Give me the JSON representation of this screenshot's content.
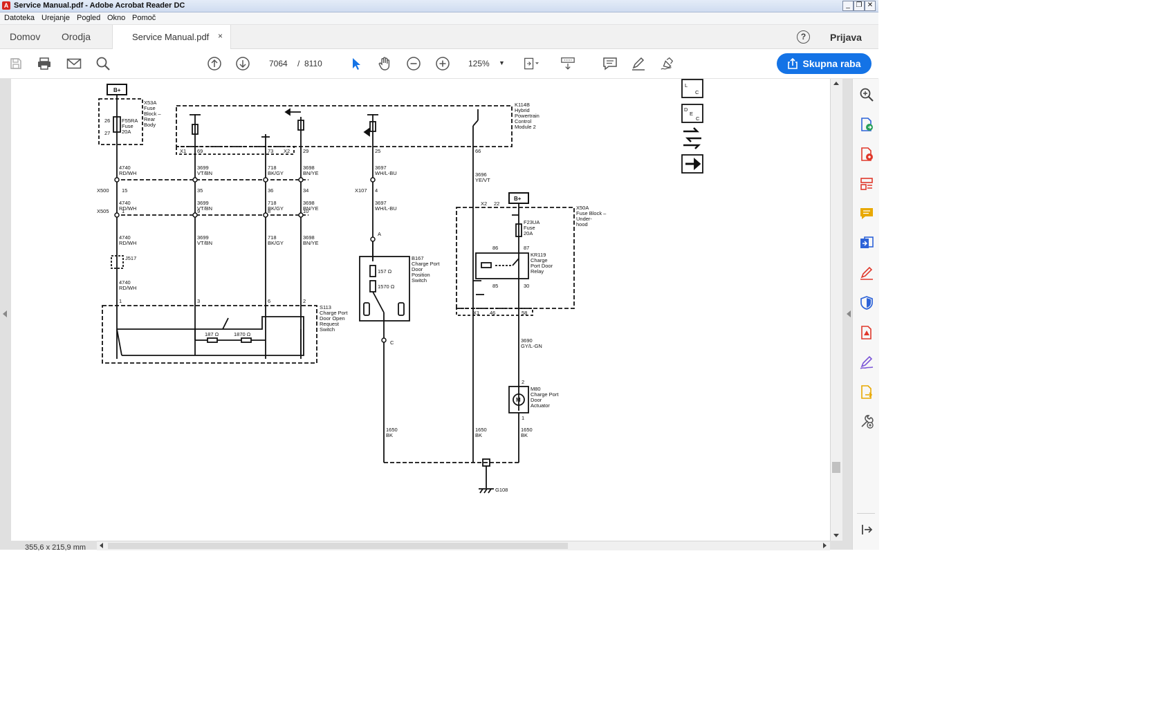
{
  "window": {
    "title": "Service  Manual.pdf - Adobe Acrobat Reader DC",
    "controls": [
      "_",
      "❐",
      "✕"
    ]
  },
  "menu": [
    "Datoteka",
    "Urejanje",
    "Pogled",
    "Okno",
    "Pomoč"
  ],
  "tabs": {
    "home": "Domov",
    "tools": "Orodja",
    "document": "Service  Manual.pdf",
    "close": "×"
  },
  "header": {
    "help": "?",
    "signin": "Prijava"
  },
  "toolbar": {
    "current_page": "7064",
    "page_separator": "/",
    "total_pages": "8110",
    "zoom": "125%",
    "share_label": "Skupna raba",
    "icons": [
      "save-icon",
      "print-icon",
      "email-icon",
      "search-icon",
      "page-up-icon",
      "page-down-icon",
      "select-cursor-icon",
      "hand-icon",
      "zoom-out-icon",
      "zoom-in-icon",
      "fit-page-icon",
      "scroll-mode-icon",
      "comment-icon",
      "highlight-pen-icon",
      "sign-icon",
      "share-icon"
    ]
  },
  "status": {
    "page_size": "355,6 x 215,9 mm"
  },
  "right_panel": {
    "icons": [
      "zoom-tool-icon",
      "export-pdf-icon",
      "create-pdf-icon",
      "organize-pages-icon",
      "comment-tool-icon",
      "send-for-review-icon",
      "fill-sign-icon",
      "protect-icon",
      "optimize-pdf-icon",
      "request-signature-icon",
      "send-file-icon",
      "more-tools-icon",
      "collapse-panel-icon"
    ],
    "colors": {
      "red": "#e0382b",
      "blue": "#2d63d8",
      "yellow": "#e8a800",
      "purple": "#7b55d8"
    }
  },
  "schematic": {
    "b_plus_left": "B+",
    "b_plus_right": "B+",
    "x53a": [
      "X53A",
      "Fuse",
      "Block –",
      "Rear",
      "Body"
    ],
    "f55ra": [
      "F55RA",
      "Fuse",
      "20A"
    ],
    "x53a_pins": [
      "26",
      "27"
    ],
    "k114b": [
      "K114B",
      "Hybrid",
      "Powertrain",
      "Control",
      "Module 2"
    ],
    "k114b_conn": [
      "X1",
      "69",
      "73",
      "X2",
      "29",
      "25",
      "66"
    ],
    "wire_4740_rdwh": [
      "4740",
      "RD/WH"
    ],
    "wire_3699_vtbn": [
      "3699",
      "VT/BN"
    ],
    "wire_718_bkgy": [
      "718",
      "BK/GY"
    ],
    "wire_3698_bnye": [
      "3698",
      "BN/YE"
    ],
    "wire_3697_whlbu": [
      "3697",
      "WH/L-BU"
    ],
    "wire_3696_yevt": [
      "3696",
      "YE/VT"
    ],
    "x500": [
      "X500",
      "15",
      "35",
      "36",
      "34"
    ],
    "x107": [
      "X107",
      "4"
    ],
    "x505": [
      "X505",
      "1",
      "9",
      "8",
      "10"
    ],
    "j517": "J517",
    "s113": [
      "S113",
      "Charge Port",
      "Door Open",
      "Request",
      "Switch"
    ],
    "s113_pins": [
      "1",
      "3",
      "6",
      "2"
    ],
    "s113_res": [
      "187 Ω",
      "1870 Ω"
    ],
    "b167": [
      "B167",
      "Charge Port",
      "Door",
      "Position",
      "Switch"
    ],
    "b167_res": [
      "157 Ω",
      "1570 Ω"
    ],
    "b167_pins": [
      "A",
      "C"
    ],
    "x50a": [
      "X50A",
      "Fuse Block –",
      "Under-",
      "hood"
    ],
    "x50a_conn": [
      "X2",
      "22"
    ],
    "f23ua": [
      "F23UA",
      "Fuse",
      "20A"
    ],
    "kr119": [
      "KR119",
      "Charge",
      "Port Door",
      "Relay"
    ],
    "kr119_pins": [
      "86",
      "87",
      "85",
      "30"
    ],
    "x1_pins": [
      "X1",
      "46",
      "58"
    ],
    "wire_3690_gylgn": [
      "3690",
      "GY/L-GN"
    ],
    "m80": [
      "M80",
      "Charge Port",
      "Door",
      "Actuator"
    ],
    "m80_pins": [
      "2",
      "1"
    ],
    "m80_symbol": "M",
    "ground_wires": [
      "1650",
      "BK"
    ],
    "ground": "G108",
    "legend_boxes": [
      "L",
      "D",
      "E",
      "C"
    ]
  }
}
